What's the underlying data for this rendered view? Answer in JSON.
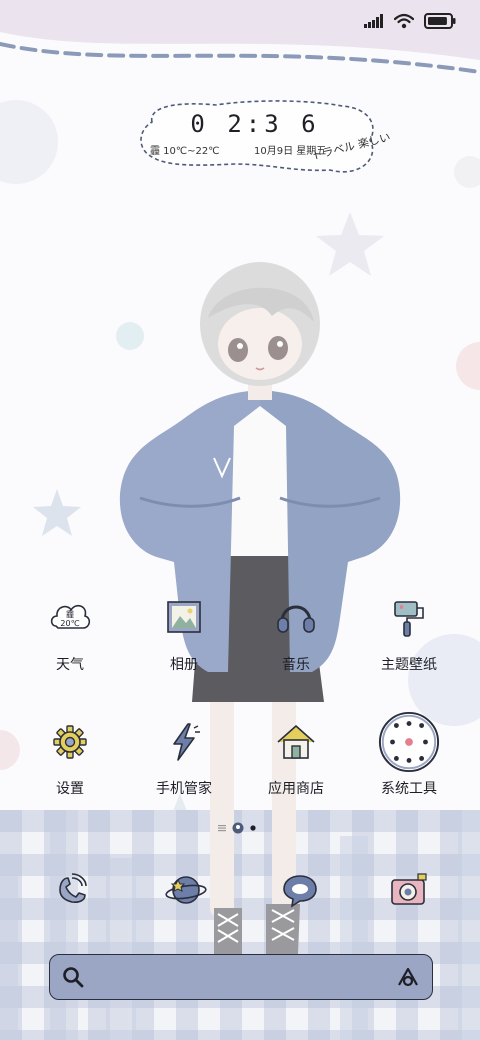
{
  "status_bar": {
    "signal_icon": "signal-bars-icon",
    "wifi_icon": "wifi-icon",
    "battery_icon": "battery-icon",
    "battery_level": 0.9
  },
  "clock_widget": {
    "time": "0 2:3 6",
    "weather": "霾 10℃~22℃",
    "date": "10月9日 星期五",
    "deco_text": "トラベル 楽しい"
  },
  "apps": [
    {
      "label": "天气",
      "icon": "weather-icon",
      "badge": "霾 20℃"
    },
    {
      "label": "相册",
      "icon": "gallery-icon"
    },
    {
      "label": "音乐",
      "icon": "headphones-icon"
    },
    {
      "label": "主题壁纸",
      "icon": "paint-brush-icon"
    },
    {
      "label": "设置",
      "icon": "gear-icon"
    },
    {
      "label": "手机管家",
      "icon": "lightning-icon"
    },
    {
      "label": "应用商店",
      "icon": "house-icon"
    },
    {
      "label": "系统工具",
      "icon": "folder-icon"
    }
  ],
  "dock": [
    {
      "icon": "phone-icon"
    },
    {
      "icon": "planet-browser-icon"
    },
    {
      "icon": "message-bubble-icon"
    },
    {
      "icon": "camera-icon"
    }
  ],
  "page_indicator": {
    "pages": 2,
    "current": 2
  },
  "search": {
    "placeholder": ""
  },
  "colors": {
    "accent": "#9aa6c4",
    "outline": "#2b2f3d",
    "band": "#ebe3ee"
  }
}
